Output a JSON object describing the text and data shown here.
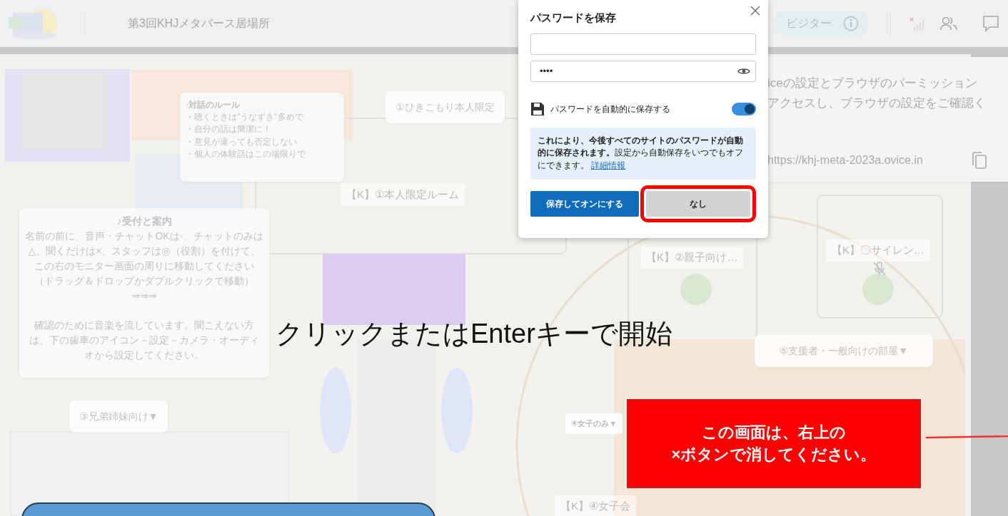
{
  "header": {
    "title": "第3回KHJメタバース居場所",
    "role_badge": "ビジター"
  },
  "map": {
    "notes": [
      {
        "title": "◦対話のルール",
        "lines": [
          "・聴くときは\"うなずき\"多めで",
          "・自分の話は簡潔に！",
          "・意見が違っても否定しない",
          "・個人の体験話はこの場限りで"
        ]
      },
      {
        "title": "♪受付と案内",
        "lines": [
          "名前の前に、音声・チャットOKは◦、チャットのみは△、聞くだけは×、スタッフは◎（役割）を付けて、この右のモニター画面の周りに移動してください（ドラッグ＆ドロップかダブルクリックで移動）⇒⇒⇒",
          "確認のために音楽を流しています。聞こえない方は、下の歯車のアイコン－設定－カメラ・オーディオから設定してください。"
        ]
      }
    ],
    "labels": [
      {
        "text": "①ひきこもり本人限定",
        "kind": "tag"
      },
      {
        "text": "【K】①本人限定ルーム",
        "kind": "room"
      },
      {
        "text": "【K】②親子向け…",
        "kind": "room"
      },
      {
        "text": "【K】〇サイレン…",
        "kind": "room"
      },
      {
        "text": "⑤支援者・一般向けの部屋▼",
        "kind": "tag"
      },
      {
        "text": "③兄弟姉妹向け▼",
        "kind": "tag"
      },
      {
        "text": "④女子のみ▼",
        "kind": "mini"
      },
      {
        "text": "【K】④女子会",
        "kind": "room"
      }
    ]
  },
  "start_prompt": "クリックまたはEnterキーで開始",
  "notice_panel": {
    "lines": [
      "iceの設定とブラウザのパーミッション",
      "アクセスし、ブラウザの設定をご確認く"
    ],
    "url": "https://khj-meta-2023a.ovice.in"
  },
  "password_dialog": {
    "title": "パスワードを保存",
    "password": "••••",
    "auto_save": {
      "label": "パスワードを自動的に保存する",
      "on": true
    },
    "info": "**これにより、今後すべてのサイトのパスワードが自動的に保存されます。**設定から自動保存をいつでもオフにできます。",
    "info_link": "詳細情報",
    "buttons": [
      {
        "label": "保存してオンにする",
        "kind": "primary",
        "highlighted": false
      },
      {
        "label": "なし",
        "kind": "secondary",
        "highlighted": true
      }
    ]
  },
  "callout": {
    "lines": [
      "この画面は、右上の",
      "×ボタンで消してください。"
    ]
  }
}
